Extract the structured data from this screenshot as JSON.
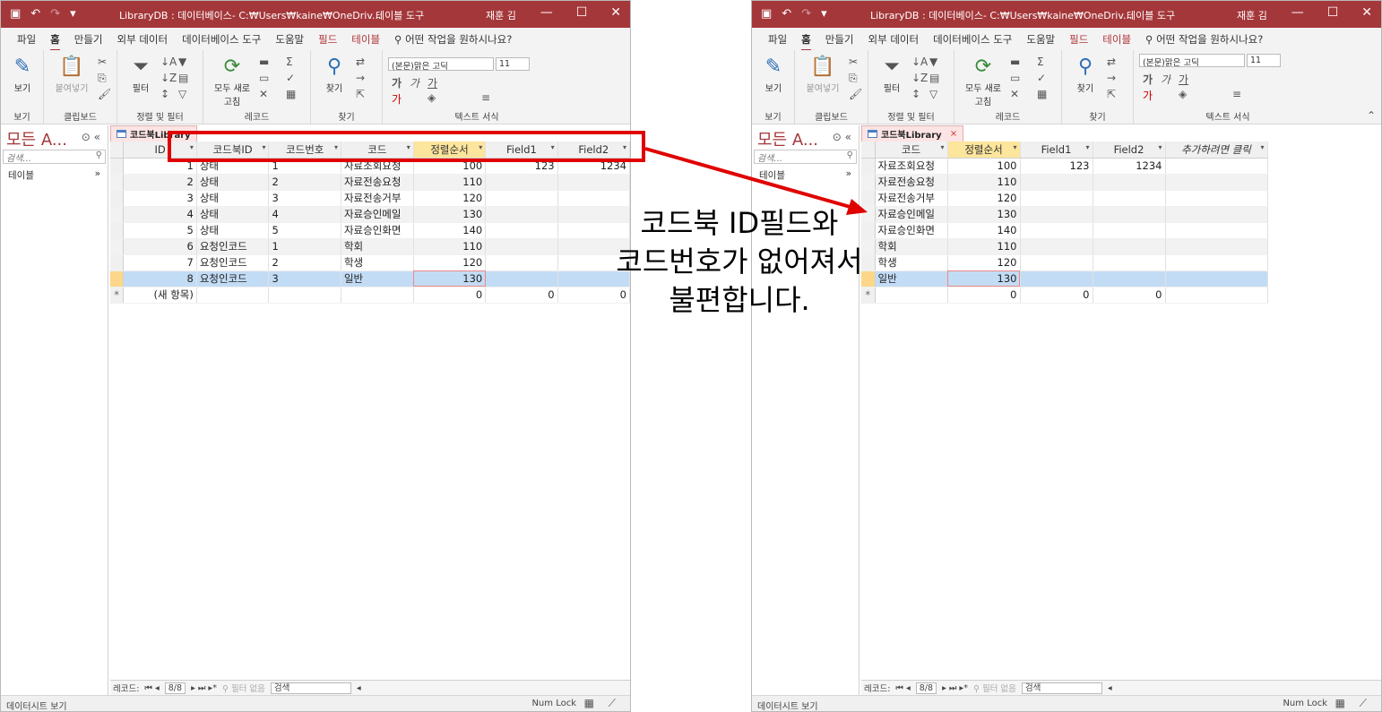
{
  "left": {
    "title": "LibraryDB : 데이터베이스- C:₩Users₩kaine₩OneDriv...",
    "context_tool": "테이블 도구",
    "user": "재훈 김",
    "tabs": [
      "파일",
      "홈",
      "만들기",
      "외부 데이터",
      "데이터베이스 도구",
      "도움말",
      "필드",
      "테이블"
    ],
    "tell_me": "어떤 작업을 원하시나요?",
    "groups": [
      "보기",
      "클립보드",
      "정렬 및 필터",
      "레코드",
      "찾기",
      "텍스트 서식"
    ],
    "buttons": {
      "view": "보기",
      "paste": "붙여넣기",
      "filter": "필터",
      "refresh": "모두 새로 고침",
      "find": "찾기"
    },
    "font_name": "(본문)맑은 고딕",
    "font_size": "11",
    "nav_title": "모든 A...",
    "nav_search": "검색...",
    "nav_group": "테이블",
    "doc_tab": "코드북Library",
    "columns": [
      "ID",
      "코드북ID",
      "코드번호",
      "코드",
      "정렬순서",
      "Field1",
      "Field2"
    ],
    "rows": [
      [
        "1",
        "상태",
        "1",
        "자료조회요청",
        "100",
        "123",
        "1234"
      ],
      [
        "2",
        "상태",
        "2",
        "자료전송요청",
        "110",
        "",
        ""
      ],
      [
        "3",
        "상태",
        "3",
        "자료전송거부",
        "120",
        "",
        ""
      ],
      [
        "4",
        "상태",
        "4",
        "자료승인메일",
        "130",
        "",
        ""
      ],
      [
        "5",
        "상태",
        "5",
        "자료승인화면",
        "140",
        "",
        ""
      ],
      [
        "6",
        "요청인코드",
        "1",
        "학회",
        "110",
        "",
        ""
      ],
      [
        "7",
        "요청인코드",
        "2",
        "학생",
        "120",
        "",
        ""
      ],
      [
        "8",
        "요청인코드",
        "3",
        "일반",
        "130",
        "",
        ""
      ]
    ],
    "new_row": [
      "(새 항목)",
      "",
      "",
      "",
      "0",
      "0",
      "0"
    ],
    "new_marker": "*",
    "record_label": "레코드:",
    "record_pos": "8/8",
    "no_filter": "필터 없음",
    "search": "검색",
    "status_left": "데이터시트 보기",
    "status_right": "Num Lock"
  },
  "right": {
    "title": "LibraryDB : 데이터베이스- C:₩Users₩kaine₩OneDriv...",
    "context_tool": "테이블 도구",
    "user": "재훈 김",
    "tabs": [
      "파일",
      "홈",
      "만들기",
      "외부 데이터",
      "데이터베이스 도구",
      "도움말",
      "필드",
      "테이블"
    ],
    "tell_me": "어떤 작업을 원하시나요?",
    "groups": [
      "보기",
      "클립보드",
      "정렬 및 필터",
      "레코드",
      "찾기",
      "텍스트 서식"
    ],
    "buttons": {
      "view": "보기",
      "paste": "붙여넣기",
      "filter": "필터",
      "refresh": "모두 새로 고침",
      "find": "찾기"
    },
    "font_name": "(본문)맑은 고딕",
    "font_size": "11",
    "nav_title": "모든 A...",
    "nav_search": "검색...",
    "nav_group": "테이블",
    "doc_tab": "코드북Library",
    "columns": [
      "코드",
      "정렬순서",
      "Field1",
      "Field2",
      "추가하려면 클릭"
    ],
    "rows": [
      [
        "자료조회요청",
        "100",
        "123",
        "1234",
        ""
      ],
      [
        "자료전송요청",
        "110",
        "",
        "",
        ""
      ],
      [
        "자료전송거부",
        "120",
        "",
        "",
        ""
      ],
      [
        "자료승인메일",
        "130",
        "",
        "",
        ""
      ],
      [
        "자료승인화면",
        "140",
        "",
        "",
        ""
      ],
      [
        "학회",
        "110",
        "",
        "",
        ""
      ],
      [
        "학생",
        "120",
        "",
        "",
        ""
      ],
      [
        "일반",
        "130",
        "",
        "",
        ""
      ]
    ],
    "new_row": [
      "",
      "0",
      "0",
      "0",
      ""
    ],
    "new_marker": "*",
    "record_label": "레코드:",
    "record_pos": "8/8",
    "no_filter": "필터 없음",
    "search": "검색",
    "status_left": "데이터시트 보기",
    "status_right": "Num Lock"
  },
  "annotation": {
    "lines": [
      "코드북 ID필드와",
      "코드번호가 없어져서",
      "불편합니다."
    ],
    "color": "#e00000"
  },
  "colors": {
    "access_red": "#a4373a",
    "sorted_header": "#fce59c",
    "current_row": "#c3dcf5"
  }
}
